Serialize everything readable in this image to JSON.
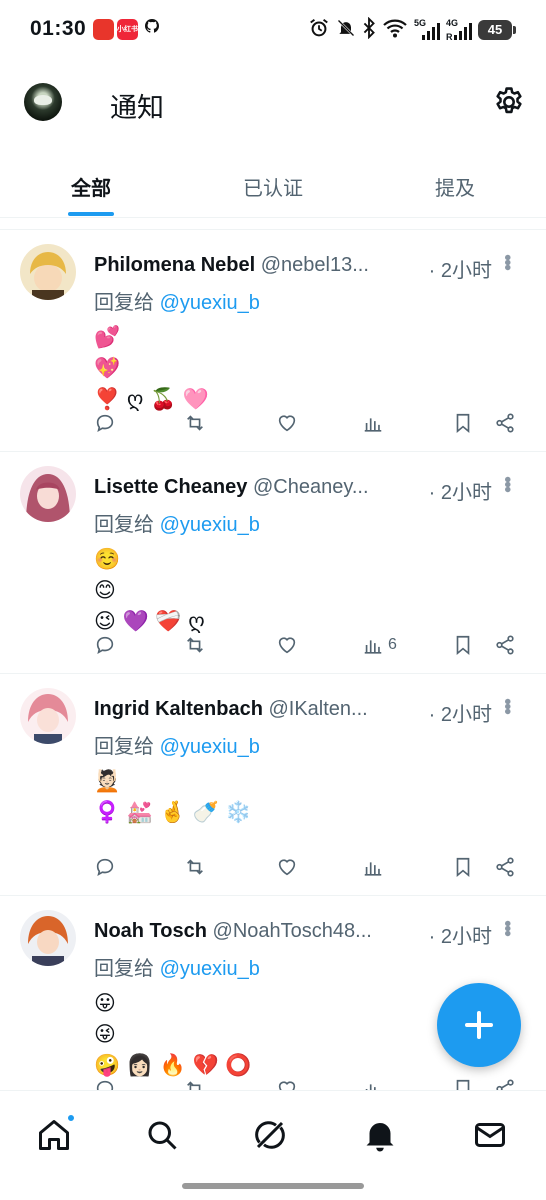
{
  "status_bar": {
    "time": "01:30",
    "app1": "",
    "app2": "小红书",
    "net1": "5G",
    "net2": "4G",
    "net2_sub": "R",
    "battery": "45"
  },
  "header": {
    "title": "通知"
  },
  "tabs": [
    {
      "label": "全部",
      "active": true
    },
    {
      "label": "已认证",
      "active": false
    },
    {
      "label": "提及",
      "active": false
    }
  ],
  "tweets": [
    {
      "name": "Philomena Nebel",
      "handle": "@nebel13...",
      "time": "· 2小时",
      "reply_prefix": "回复给",
      "mention": "@yuexiu_b",
      "emoji_lines": [
        "💕",
        "💖",
        "❣️ ღ 🍒 🩷"
      ],
      "views": ""
    },
    {
      "name": "Lisette Cheaney",
      "handle": "@Cheaney...",
      "time": "· 2小时",
      "reply_prefix": "回复给",
      "mention": "@yuexiu_b",
      "emoji_lines": [
        "☺️",
        "😊",
        "😉 💜 ❤️‍🩹 ღ"
      ],
      "views": "6"
    },
    {
      "name": "Ingrid Kaltenbach",
      "handle": "@IKalten...",
      "time": "· 2小时",
      "reply_prefix": "回复给",
      "mention": "@yuexiu_b",
      "emoji_lines": [
        "💆🏻",
        "♀️ 💒 🤞 🍼 ❄️"
      ],
      "views": ""
    },
    {
      "name": "Noah Tosch",
      "handle": "@NoahTosch48...",
      "time": "· 2小时",
      "reply_prefix": "回复给",
      "mention": "@yuexiu_b",
      "emoji_lines": [
        "😛",
        "😜",
        "🤪 👩🏻 🔥 💔 ⭕"
      ],
      "views": ""
    }
  ],
  "icons": {
    "reply": "reply-icon",
    "retweet": "retweet-icon",
    "like": "like-icon",
    "views": "views-icon",
    "bookmark": "bookmark-icon",
    "share": "share-icon",
    "more": "more-icon",
    "settings": "gear-icon",
    "compose": "plus-icon"
  },
  "bottom_nav": [
    "home-icon",
    "search-icon",
    "grok-icon",
    "bell-icon",
    "mail-icon"
  ],
  "colors": {
    "accent": "#1d9bf0",
    "text": "#0f1419",
    "muted": "#536471"
  }
}
